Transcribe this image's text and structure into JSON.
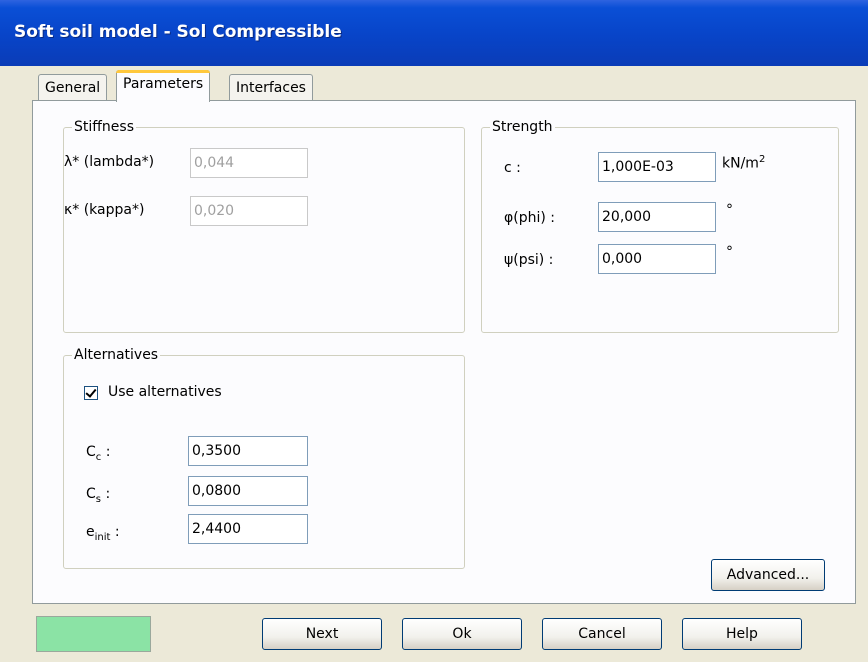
{
  "window": {
    "title": "Soft soil model - Sol Compressible"
  },
  "tabs": [
    {
      "label": "General"
    },
    {
      "label": "Parameters"
    },
    {
      "label": "Interfaces"
    }
  ],
  "stiffness": {
    "legend": "Stiffness",
    "lambda_label": "λ* (lambda*)",
    "lambda_value": "0,044",
    "kappa_label": "κ* (kappa*)",
    "kappa_value": "0,020"
  },
  "strength": {
    "legend": "Strength",
    "c_label": "c :",
    "c_value": "1,000E-03",
    "c_unit": "kN/m",
    "c_unit_exp": "2",
    "phi_label": "φ(phi) :",
    "phi_value": "20,000",
    "phi_unit": "°",
    "psi_label": "ψ(psi) :",
    "psi_value": "0,000",
    "psi_unit": "°"
  },
  "alternatives": {
    "legend": "Alternatives",
    "use_label": "Use alternatives",
    "use_checked": true,
    "cc_base": "C",
    "cc_sub": "c",
    "cc_suffix": " :",
    "cc_value": "0,3500",
    "cs_base": "C",
    "cs_sub": "s",
    "cs_suffix": " :",
    "cs_value": "0,0800",
    "e_base": "e",
    "e_sub": "init",
    "e_suffix": " :",
    "e_value": "2,4400"
  },
  "buttons": {
    "advanced": "Advanced...",
    "next": "Next",
    "ok": "Ok",
    "cancel": "Cancel",
    "help": "Help"
  },
  "colors": {
    "status_indicator": "#8be3a5",
    "title_bar": "#0a4fd6"
  }
}
